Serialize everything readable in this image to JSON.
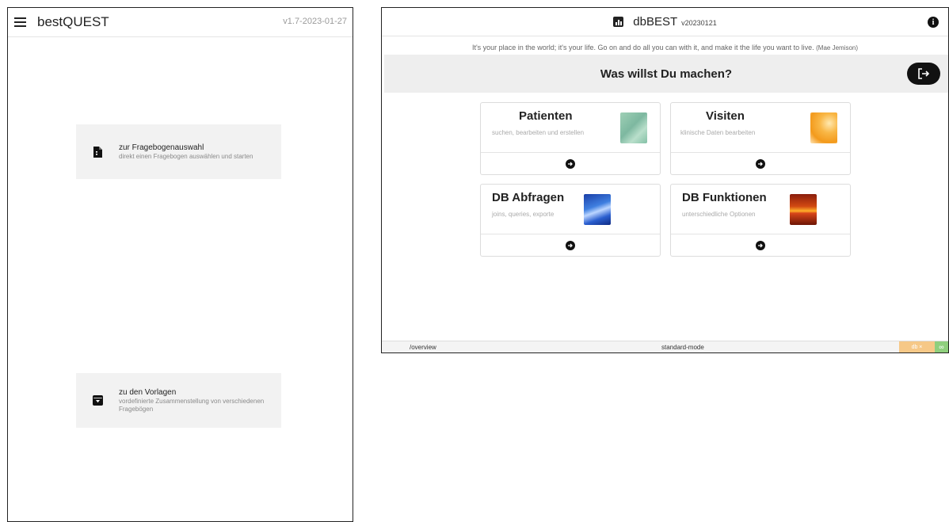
{
  "bestquest": {
    "title": "bestQUEST",
    "version": "v1.7-2023-01-27",
    "cards": [
      {
        "title": "zur Fragebogenauswahl",
        "description": "direkt einen Fragebogen auswählen und starten",
        "icon": "document-icon"
      },
      {
        "title": "zu den Vorlagen",
        "description": "vordefinierte Zusammenstellung von verschiedenen Fragebögen",
        "icon": "archive-icon"
      }
    ]
  },
  "dbbest": {
    "title": "dbBEST",
    "version": "v20230121",
    "quote": "It's your place in the world; it's your life. Go on and do all you can with it, and make it the life you want to live.",
    "quote_author": "(Mae Jemison)",
    "banner_title": "Was willst Du machen?",
    "cards": [
      {
        "title": "Patienten",
        "subtitle": "suchen, bearbeiten und erstellen",
        "image": "green-texture"
      },
      {
        "title": "Visiten",
        "subtitle": "klinische Daten bearbeiten",
        "image": "orange-slice"
      },
      {
        "title": "DB Abfragen",
        "subtitle": "joins, queries, exporte",
        "image": "blue-abstract"
      },
      {
        "title": "DB Funktionen",
        "subtitle": "unterschiedliche Optionen",
        "image": "sunset"
      }
    ],
    "status": {
      "path": "/overview",
      "mode": "standard-mode",
      "db_badge": "db ×",
      "infinity_badge": "∞"
    }
  },
  "colors": {
    "accent": "#111111",
    "card_bg": "#f2f2f2",
    "badge_db": "#f6c887",
    "badge_inf": "#8fcf7d"
  }
}
